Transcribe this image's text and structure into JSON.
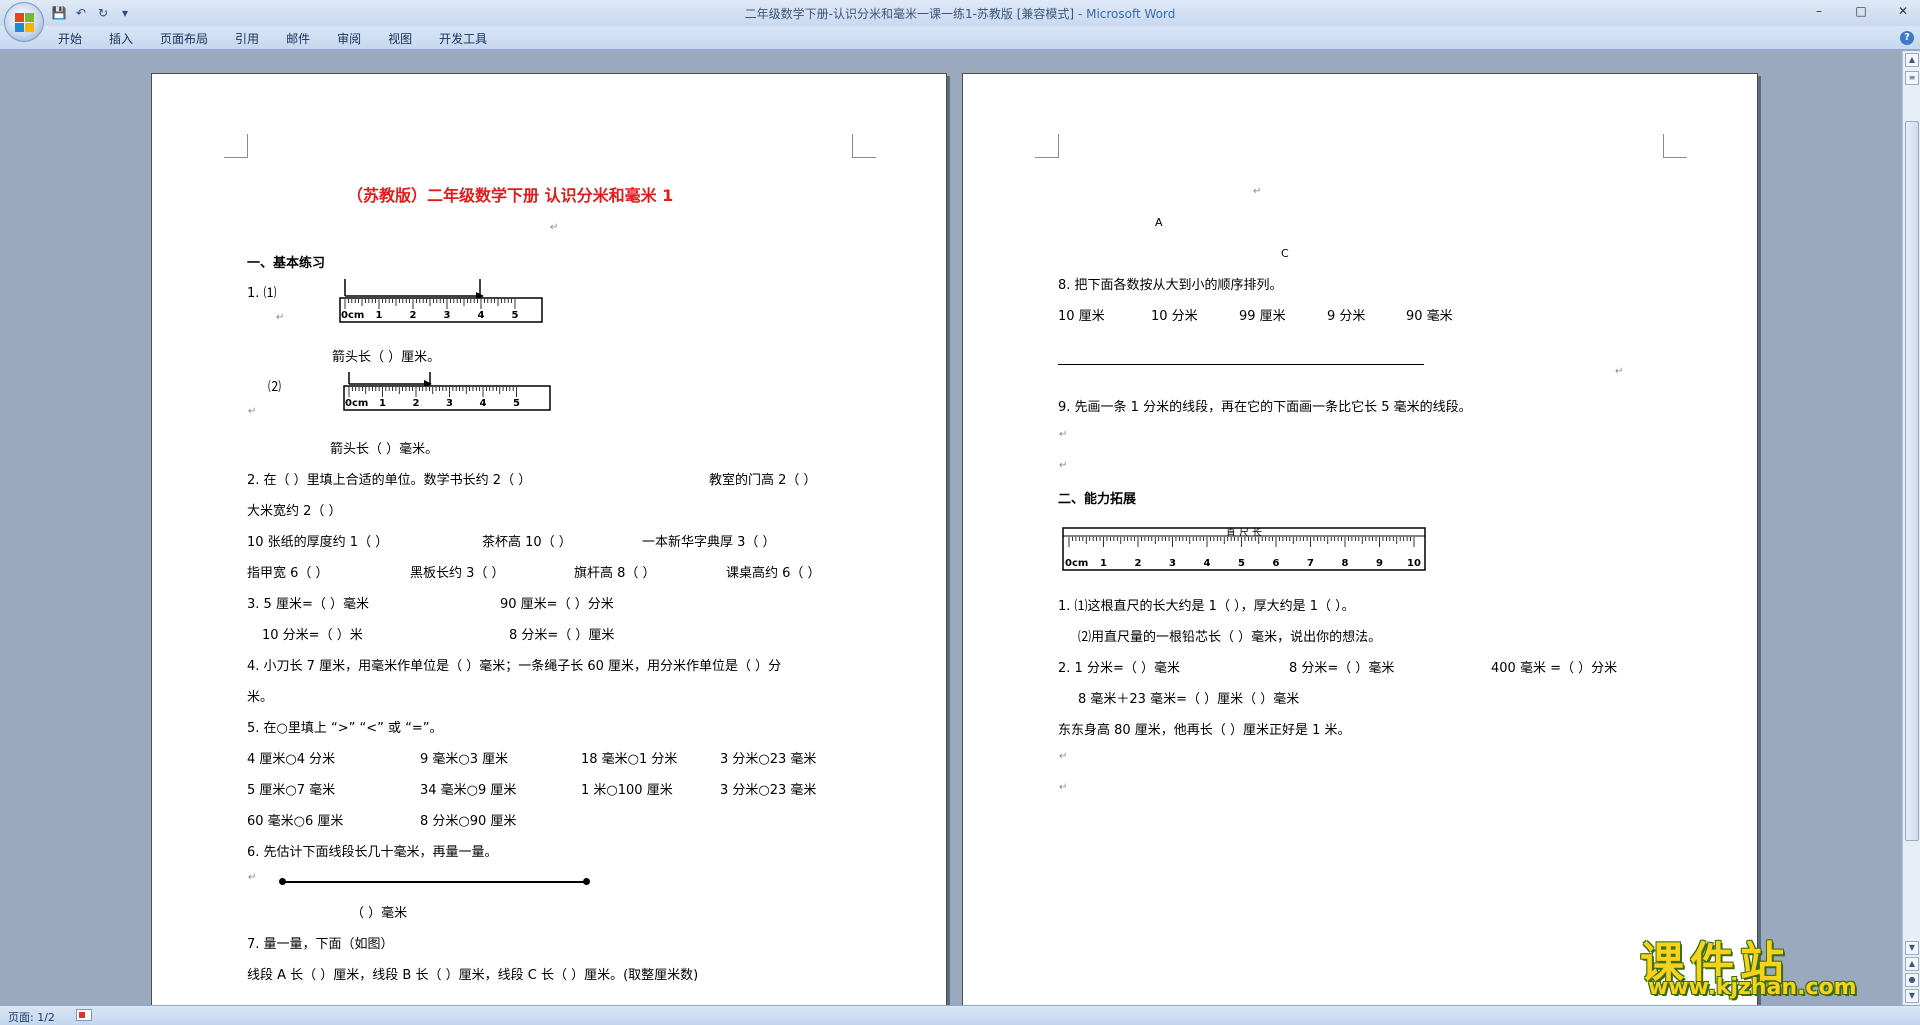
{
  "window": {
    "title": "二年级数学下册-认识分米和毫米一课一练1-苏教版 [兼容模式]",
    "app": " - Microsoft Word",
    "controls": [
      "–",
      "□",
      "✕"
    ]
  },
  "qat": {
    "save": "💾",
    "undo": "↶",
    "redo": "↻",
    "more": "▾"
  },
  "ribbon": {
    "tabs": [
      "开始",
      "插入",
      "页面布局",
      "引用",
      "邮件",
      "审阅",
      "视图",
      "开发工具"
    ],
    "help": "?"
  },
  "status": {
    "page": "页面: 1/2"
  },
  "page1": {
    "title": "（苏教版）二年级数学下册  认识分米和毫米  1",
    "s1": "一、基本练习",
    "q1a": "1.  ⑴",
    "q1a_ans": "箭头长（      ）厘米。",
    "q1b": "⑵",
    "q1b_ans": "箭头长（      ）毫米。",
    "q2a": "2.  在（     ）里填上合适的单位。数学书长约  2（       ）",
    "q2b": "教室的门高  2（       ）",
    "q2c": "大米宽约 2（      ）",
    "q2d": "10 张纸的厚度约 1（    ）",
    "q2e": "茶杯高 10（     ）",
    "q2f": "一本新华字典厚 3（     ）",
    "q2g": "指甲宽 6（      ）",
    "q2h": "黑板长约 3（      ）",
    "q2i": "旗杆高 8（      ）",
    "q2j": "课桌高约 6（      ）",
    "q3a": "3.  5 厘米=（     ）毫米",
    "q3b": "90 厘米=（     ）分米",
    "q3c": "10 分米=（     ）米",
    "q3d": "8 分米=（     ）厘米",
    "q4a": "4.  小刀长 7 厘米，用毫米作单位是（     ）毫米；一条绳子长 60 厘米，用分米作单位是（      ）分",
    "q4b": "米。",
    "q5": "5.  在○里填上 “>” “<” 或 “=”。",
    "q5r1": [
      "4 厘米○4 分米",
      "9 毫米○3 厘米",
      "18 毫米○1 分米",
      "3 分米○23 毫米"
    ],
    "q5r2": [
      "5 厘米○7 毫米",
      "34 毫米○9 厘米",
      "1 米○100 厘米",
      "3 分米○23 毫米"
    ],
    "q5r3": [
      "60 毫米○6 厘米",
      "8 分米○90 厘米"
    ],
    "q6": "6.  先估计下面线段长几十毫米，再量一量。",
    "q6ans": "（           ）毫米",
    "q7": "7.  量一量，下面（如图）",
    "q7b": "线段 A 长（     ）厘米，线段 B 长（     ）厘米，线段 C 长（     ）厘米。(取整厘米数)"
  },
  "page2": {
    "labA": "A",
    "labC": "C",
    "q8": "8.  把下面各数按从大到小的顺序排列。",
    "q8vals": [
      "10 厘米",
      "10 分米",
      "99 厘米",
      "9 分米",
      "90 毫米"
    ],
    "q9": "9.  先画一条 1 分米的线段，再在它的下面画一条比它长 5 毫米的线段。",
    "s2": "二、能力拓展",
    "ruler_label": "直 尺 长",
    "e1a": "1.  ⑴这根直尺的长大约是 1（          ），厚大约是 1（          ）。",
    "e1b": "⑵用直尺量的一根铅芯长（      ）毫米，说出你的想法。",
    "e2a": "2.  1 分米=（      ）毫米",
    "e2b": "8 分米=（      ）毫米",
    "e2c": "400 毫米 =（   ）分米",
    "e2d": "8 毫米＋23 毫米=（     ）厘米（      ）毫米",
    "e3": "东东身高 80 厘米，他再长（         ）厘米正好是 1 米。"
  },
  "ruler_ticks": [
    "0cm",
    "1",
    "2",
    "3",
    "4",
    "5"
  ],
  "ruler10_ticks": [
    "0cm",
    "1",
    "2",
    "3",
    "4",
    "5",
    "6",
    "7",
    "8",
    "9",
    "10"
  ],
  "watermark": {
    "cn": "课件站",
    "url": "www.kjzhan.com"
  }
}
